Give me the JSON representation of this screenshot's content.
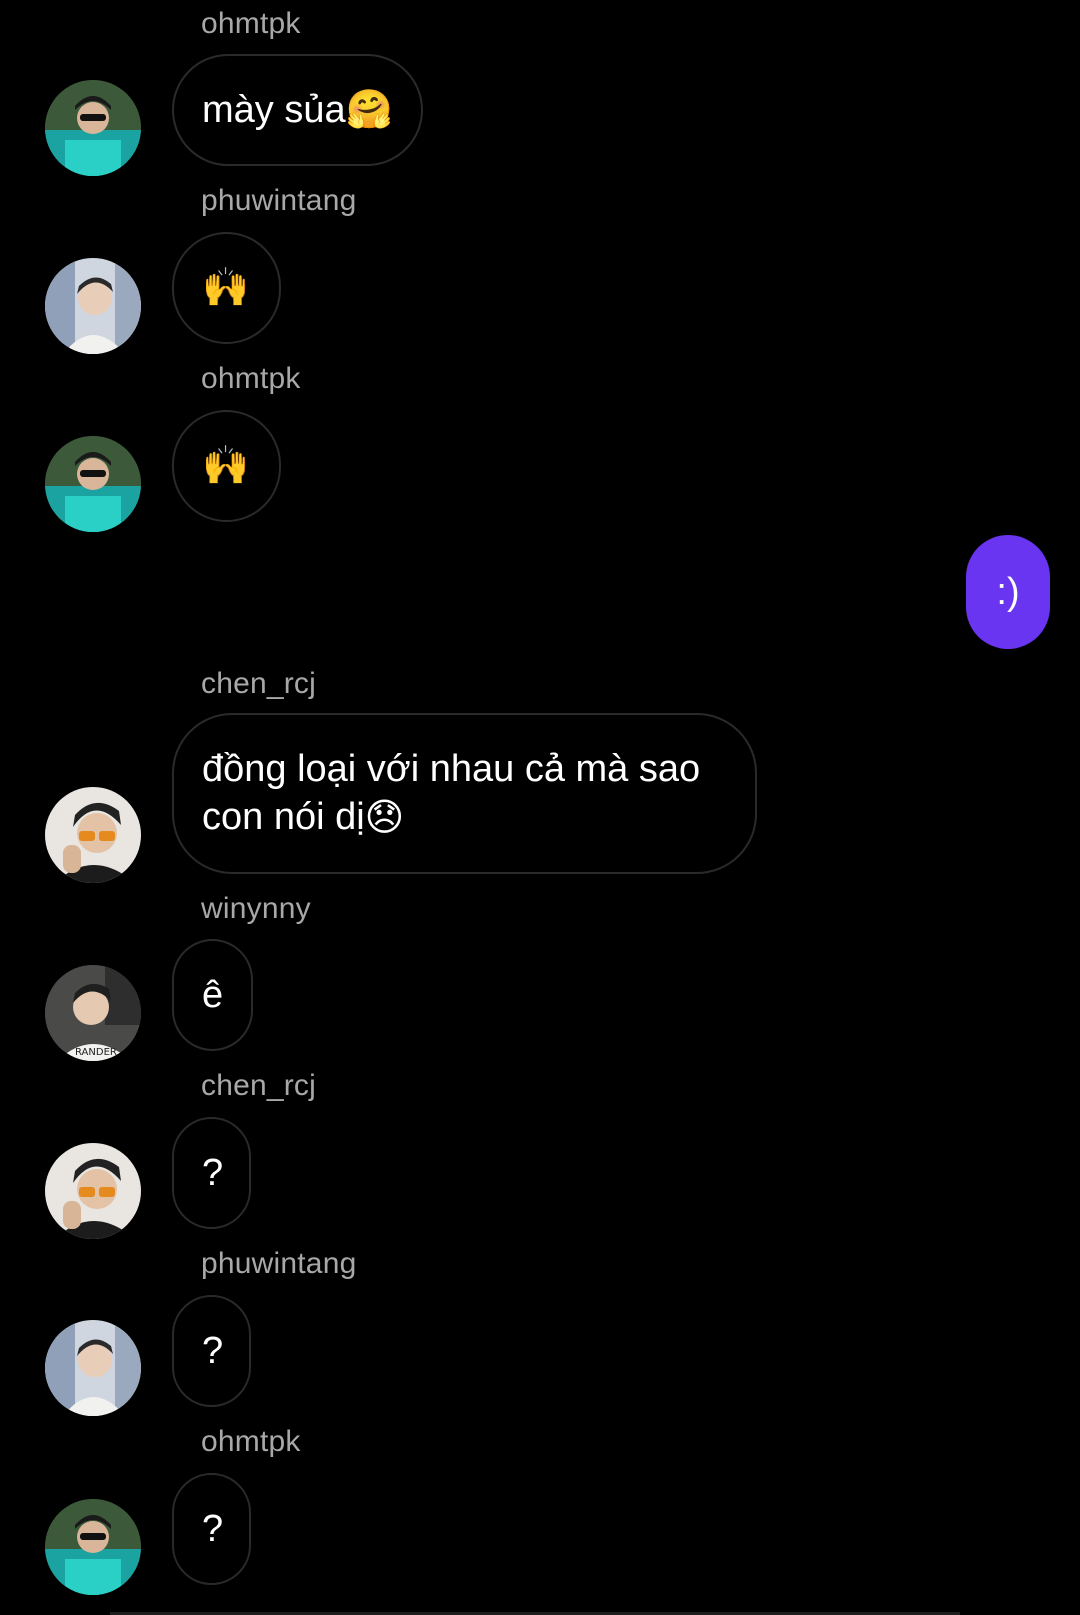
{
  "messages": [
    {
      "sender": "ohmtpk",
      "text": "mày sủa",
      "emoji": "🤗",
      "avatar": "avatar-ohmtpk"
    },
    {
      "sender": "phuwintang",
      "text": "",
      "emoji": "🙌",
      "avatar": "avatar-phuwintang"
    },
    {
      "sender": "ohmtpk",
      "text": "",
      "emoji": "🙌",
      "avatar": "avatar-ohmtpk"
    },
    {
      "sender": "chen_rcj",
      "line1": "đồng loại với nhau cả mà sao",
      "line2": "con nói dị",
      "emoji": "😞",
      "avatar": "avatar-chen"
    },
    {
      "sender": "winynny",
      "text": "ê",
      "avatar": "avatar-winynny"
    },
    {
      "sender": "chen_rcj",
      "text": "?",
      "avatar": "avatar-chen"
    },
    {
      "sender": "phuwintang",
      "text": "?",
      "avatar": "avatar-phuwintang"
    },
    {
      "sender": "ohmtpk",
      "text": "?",
      "avatar": "avatar-ohmtpk"
    }
  ],
  "own_message": {
    "text": ":)",
    "color": "#6a35f0"
  },
  "colors": {
    "background": "#000000",
    "sender": "#a8a8a8",
    "bubble_border": "#2a2a2a"
  }
}
